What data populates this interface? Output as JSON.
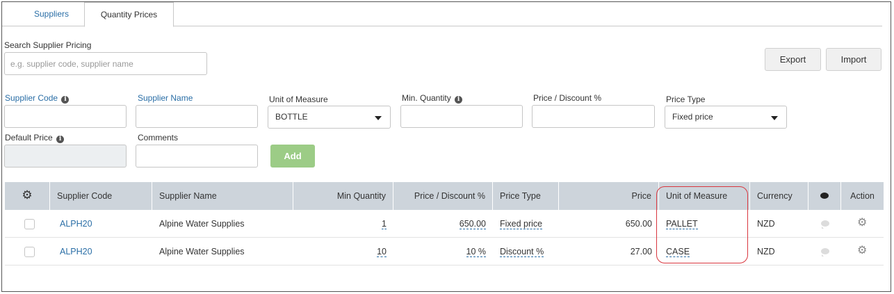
{
  "tabs": [
    {
      "label": "Suppliers",
      "active": false
    },
    {
      "label": "Quantity Prices",
      "active": true
    }
  ],
  "search": {
    "label": "Search Supplier Pricing",
    "placeholder": "e.g. supplier code, supplier name"
  },
  "toolbar": {
    "export_label": "Export",
    "import_label": "Import"
  },
  "form": {
    "supplier_code_label": "Supplier Code",
    "supplier_name_label": "Supplier Name",
    "uom_label": "Unit of Measure",
    "uom_value": "BOTTLE",
    "min_qty_label": "Min. Quantity",
    "price_discount_label": "Price / Discount %",
    "price_type_label": "Price Type",
    "price_type_value": "Fixed price",
    "default_price_label": "Default Price",
    "comments_label": "Comments",
    "add_label": "Add",
    "info_glyph": "i"
  },
  "table": {
    "headers": {
      "supplier_code": "Supplier Code",
      "supplier_name": "Supplier Name",
      "min_quantity": "Min Quantity",
      "price_discount": "Price / Discount %",
      "price_type": "Price Type",
      "price": "Price",
      "unit_of_measure": "Unit of Measure",
      "currency": "Currency",
      "action": "Action"
    },
    "rows": [
      {
        "supplier_code": "ALPH20",
        "supplier_name": "Alpine Water Supplies",
        "min_quantity": "1",
        "price_discount": "650.00",
        "price_type": "Fixed price",
        "price": "650.00",
        "unit_of_measure": "PALLET",
        "currency": "NZD"
      },
      {
        "supplier_code": "ALPH20",
        "supplier_name": "Alpine Water Supplies",
        "min_quantity": "10",
        "price_discount": "10 %",
        "price_type": "Discount %",
        "price": "27.00",
        "unit_of_measure": "CASE",
        "currency": "NZD"
      }
    ]
  },
  "icons": {
    "settings": "gear-icon",
    "comment": "comment-icon",
    "info": "info-icon"
  },
  "colors": {
    "link": "#2a6ea6",
    "header_bg": "#cdd4db",
    "add_button": "#9ccc86",
    "highlight": "#d9363e"
  }
}
